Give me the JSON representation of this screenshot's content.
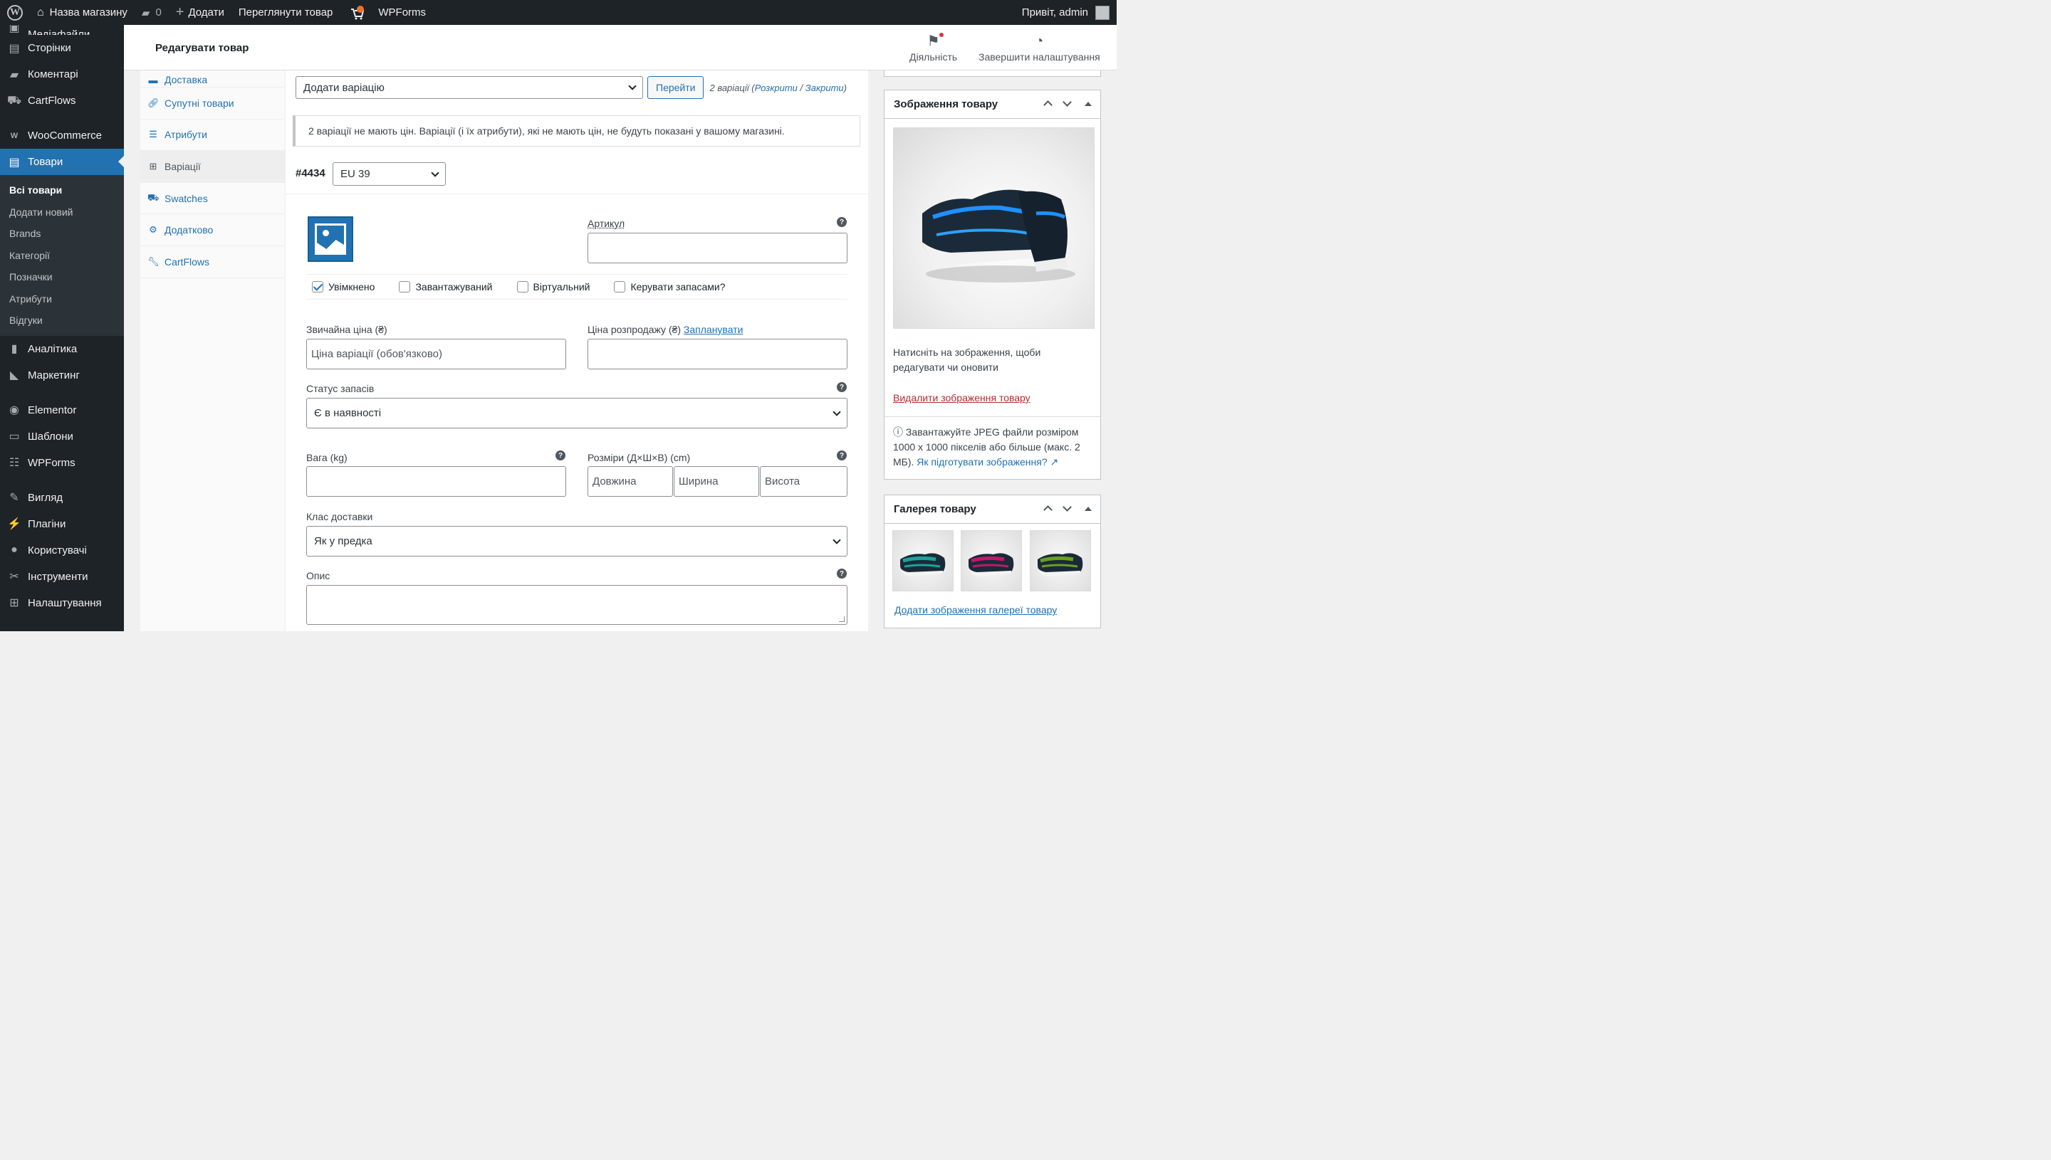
{
  "admin_bar": {
    "site_name": "Назва магазину",
    "comments_count": "0",
    "new_label": "Додати",
    "view_product": "Переглянути товар",
    "wpforms": "WPForms",
    "greeting": "Привіт, admin"
  },
  "sidebar": {
    "top_partial": "Медіафайли",
    "items_a": [
      {
        "label": "Сторінки",
        "icon": "pages-icon"
      },
      {
        "label": "Коментарі",
        "icon": "comments-icon"
      },
      {
        "label": "CartFlows",
        "icon": "cartflows-icon"
      }
    ],
    "woocommerce": "WooCommerce",
    "products": "Товари",
    "submenu": [
      "Всі товари",
      "Додати новий",
      "Brands",
      "Категорії",
      "Позначки",
      "Атрибути",
      "Відгуки"
    ],
    "items_b": [
      {
        "label": "Аналітика",
        "icon": "analytics-icon"
      },
      {
        "label": "Маркетинг",
        "icon": "megaphone-icon"
      }
    ],
    "items_c": [
      {
        "label": "Elementor",
        "icon": "elementor-icon"
      },
      {
        "label": "Шаблони",
        "icon": "folder-icon"
      },
      {
        "label": "WPForms",
        "icon": "forms-icon"
      }
    ],
    "items_d": [
      {
        "label": "Вигляд",
        "icon": "brush-icon"
      },
      {
        "label": "Плагіни",
        "icon": "plugin-icon"
      },
      {
        "label": "Користувачі",
        "icon": "users-icon"
      },
      {
        "label": "Інструменти",
        "icon": "wrench-icon"
      },
      {
        "label": "Налаштування",
        "icon": "settings-icon"
      }
    ]
  },
  "header": {
    "title": "Редагувати товар",
    "activity": "Діяльність",
    "finish_setup": "Завершити налаштування"
  },
  "tabs": {
    "partial": "Доставка",
    "linked": "Супутні товари",
    "attributes": "Атрибути",
    "variations": "Варіації",
    "swatches": "Swatches",
    "advanced": "Додатково",
    "cartflows": "CartFlows"
  },
  "variations": {
    "action_select": "Додати варіацію",
    "go_button": "Перейти",
    "count_text": "2 варіації",
    "expand": "Розкрити",
    "sep": "/",
    "close": "Закрити",
    "notice": "2 варіації не мають цін. Варіації (і їх атрибути), які не мають цін, не будуть показані у вашому магазині.",
    "variation_id": "#4434",
    "size_value": "EU 39",
    "sku_label": "Артикул",
    "sku_value": "",
    "enabled": "Увімкнено",
    "downloadable": "Завантажуваний",
    "virtual": "Віртуальний",
    "manage_stock": "Керувати запасами?",
    "regular_price_label": "Звичайна ціна (₴)",
    "regular_price_placeholder": "Ціна варіації (обов'язково)",
    "sale_price_label": "Ціна розпродажу (₴)",
    "schedule": "Запланувати",
    "stock_status_label": "Статус запасів",
    "stock_status_value": "Є в наявності",
    "weight_label": "Вага (kg)",
    "dimensions_label": "Розміри (Д×Ш×В) (cm)",
    "length": "Довжина",
    "width": "Ширина",
    "height": "Висота",
    "shipping_class_label": "Клас доставки",
    "shipping_class_value": "Як у предка",
    "description_label": "Опис"
  },
  "product_image_box": {
    "title": "Зображення товару",
    "hint": "Натисніть на зображення, щоби редагувати чи оновити",
    "remove": "Видалити зображення товару",
    "upload_tip": "Завантажуйте JPEG файли розміром 1000 x 1000 пікселів або більше (макс. 2 МБ).",
    "how_to": "Як підготувати зображення?"
  },
  "gallery_box": {
    "title": "Галерея товару",
    "add": "Додати зображення галереї товару",
    "thumb_colors": [
      "#1aa39a",
      "#c0186a",
      "#6aa020"
    ]
  }
}
